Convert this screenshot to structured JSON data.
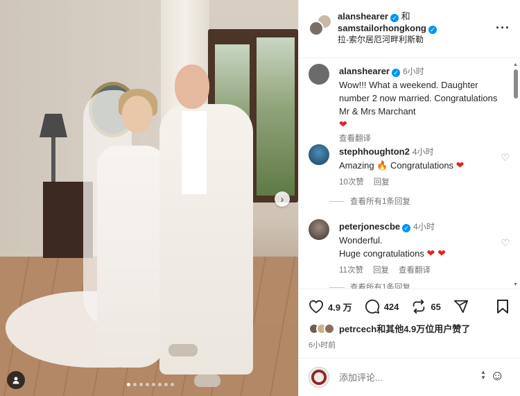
{
  "post": {
    "author1": "alanshearer",
    "conj": "和",
    "author2": "samstailorhongkong",
    "location": "拉-索尔居厄河畔利斯勒",
    "more_label": "···"
  },
  "photo": {
    "next_label": "›",
    "slide_index": 1,
    "slide_count": 8
  },
  "comments": [
    {
      "user": "alanshearer",
      "verified": true,
      "time": "6小时",
      "text": "Wow!!! What a weekend. Daughter number 2 now married. Congratulations Mr & Mrs Marchant",
      "emoji": "❤",
      "translate": "查看翻译"
    },
    {
      "user": "stephhoughton2",
      "verified": false,
      "time": "4小时",
      "text_a": "Amazing ",
      "emoji_a": "🔥",
      "text_b": " Congratulations ",
      "emoji_b": "❤",
      "likes": "10次赞",
      "reply": "回复",
      "view_replies": "查看所有1条回复"
    },
    {
      "user": "peterjonescbe",
      "verified": true,
      "time": "4小时",
      "line1": "Wonderful.",
      "line2": "Huge congratulations ",
      "emoji": "❤ ❤",
      "likes": "11次赞",
      "reply": "回复",
      "translate": "查看翻译",
      "view_replies": "查看所有1条回复"
    }
  ],
  "actions": {
    "likes": "4.9 万",
    "comments": "424",
    "reposts": "65"
  },
  "liked_by": "petrcech和其他4.9万位用户赞了",
  "posted_ago": "6小时前",
  "composer": {
    "placeholder": "添加评论..."
  },
  "colors": {
    "verified": "#0095f6",
    "heart": "#ed1c24",
    "muted": "#737373"
  }
}
